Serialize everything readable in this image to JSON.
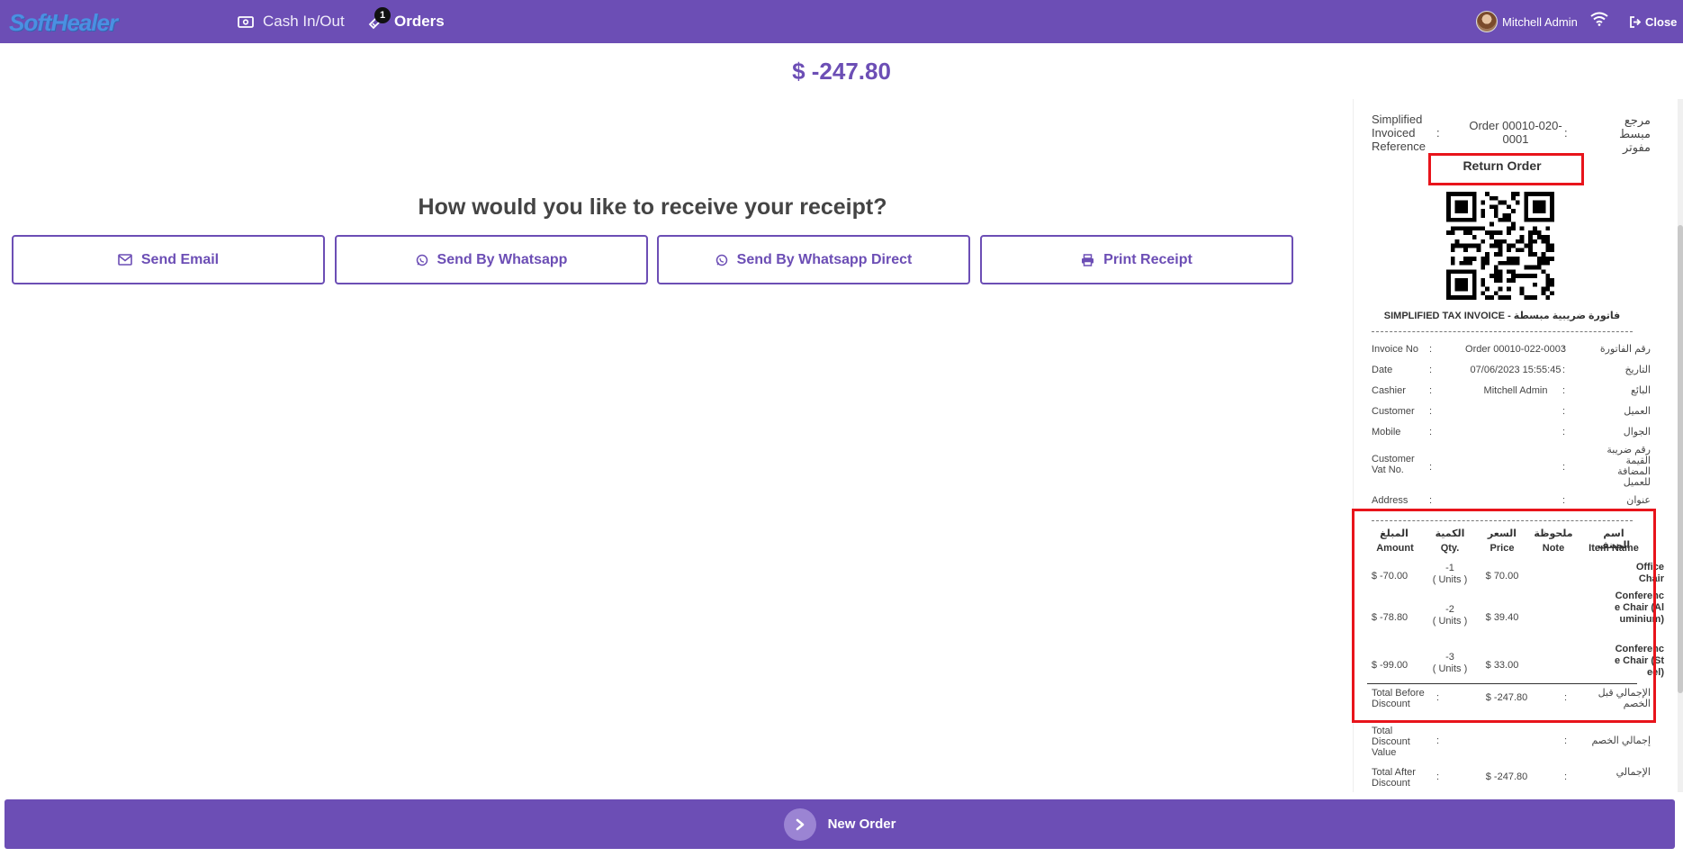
{
  "topbar": {
    "logo": "SoftHealer",
    "cash_label": "Cash In/Out",
    "orders_label": "Orders",
    "orders_badge": "1",
    "user_name": "Mitchell Admin",
    "close_label": "Close"
  },
  "payment": {
    "amount": "$ -247.80",
    "question": "How would you like to receive your receipt?",
    "buttons": {
      "email": "Send Email",
      "whatsapp": "Send By Whatsapp",
      "whatsapp_direct": "Send By Whatsapp Direct",
      "print": "Print Receipt"
    }
  },
  "receipt": {
    "ref": {
      "en": "Simplified Invoiced Reference",
      "value": "Order 00010-020-0001",
      "ar": "مرجع مبسط مفوتر"
    },
    "return_title": "Return Order",
    "invoice_title": "SIMPLIFIED TAX INVOICE - فاتورة ضريبية مبسطة",
    "fields": [
      {
        "en": "Invoice No",
        "value": "Order 00010-022-0003",
        "ar": "رقم الفاتورة"
      },
      {
        "en": "Date",
        "value": "07/06/2023 15:55:45",
        "ar": "التاريخ"
      },
      {
        "en": "Cashier",
        "value": "Mitchell Admin",
        "ar": "البائع"
      },
      {
        "en": "Customer",
        "value": "",
        "ar": "العميل"
      },
      {
        "en": "Mobile",
        "value": "",
        "ar": "الجوال"
      },
      {
        "en": "Customer Vat No.",
        "value": "",
        "ar": "رقم ضريبة القيمة المضافة للعميل"
      },
      {
        "en": "Address",
        "value": "",
        "ar": "عنوان"
      }
    ],
    "headers": {
      "amount_ar": "المبلغ",
      "amount_en": "Amount",
      "qty_ar": "الكمية",
      "qty_en": "Qty.",
      "price_ar": "السعر",
      "price_en": "Price",
      "note_ar": "ملحوظة",
      "note_en": "Note",
      "item_ar": "اسم الصنف",
      "item_en": "Item Name"
    },
    "lines": [
      {
        "amount": "$ -70.00",
        "qty": "-1",
        "unit": "( Units )",
        "price": "$ 70.00",
        "name": "Office Chair"
      },
      {
        "amount": "$ -78.80",
        "qty": "-2",
        "unit": "( Units )",
        "price": "$ 39.40",
        "name": "Conference Chair (Aluminium)"
      },
      {
        "amount": "$ -99.00",
        "qty": "-3",
        "unit": "( Units )",
        "price": "$ 33.00",
        "name": "Conference Chair (Steel)"
      }
    ],
    "totals": [
      {
        "en": "Total Before Discount",
        "value": "$ -247.80",
        "ar": "الإجمالي قبل الخصم"
      },
      {
        "en": "Total Discount Value",
        "value": "",
        "ar": "إجمالي الخصم"
      },
      {
        "en": "Total After Discount",
        "value": "$ -247.80",
        "ar": "الإجمالي"
      }
    ]
  },
  "footer": {
    "new_order": "New Order"
  },
  "colors": {
    "brand": "#6c4eb5",
    "highlight": "#e8141b"
  }
}
